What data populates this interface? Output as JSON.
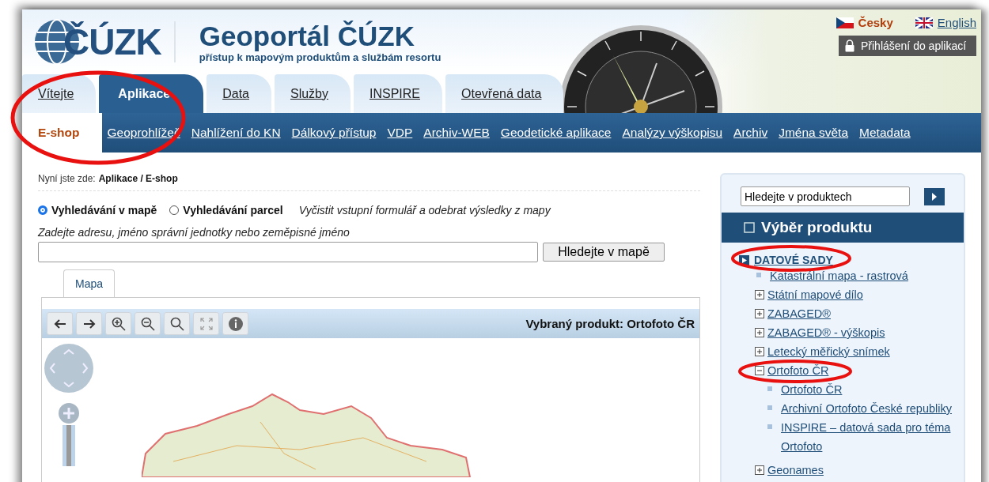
{
  "header": {
    "logo_text": "ČÚZK",
    "title": "Geoportál ČÚZK",
    "subtitle": "přístup k mapovým produktům a službám resortu",
    "languages": [
      {
        "label": "Česky",
        "selected": true
      },
      {
        "label": "English",
        "selected": false
      }
    ],
    "login_button": "Přihlášení do aplikací"
  },
  "tabs": [
    {
      "label": "Vítejte",
      "selected": false
    },
    {
      "label": "Aplikace",
      "selected": true
    },
    {
      "label": "Data",
      "selected": false
    },
    {
      "label": "Služby",
      "selected": false
    },
    {
      "label": "INSPIRE",
      "selected": false
    },
    {
      "label": "Otevřená data",
      "selected": false
    }
  ],
  "subnav": [
    {
      "label": "E-shop",
      "selected": true
    },
    {
      "label": "Geoprohlížeč",
      "selected": false
    },
    {
      "label": "Nahlížení do KN",
      "selected": false
    },
    {
      "label": "Dálkový přístup",
      "selected": false
    },
    {
      "label": "VDP",
      "selected": false
    },
    {
      "label": "Archiv-WEB",
      "selected": false
    },
    {
      "label": "Geodetické aplikace",
      "selected": false
    },
    {
      "label": "Analýzy výškopisu",
      "selected": false
    },
    {
      "label": "Archiv",
      "selected": false
    },
    {
      "label": "Jména světa",
      "selected": false
    },
    {
      "label": "Metadata",
      "selected": false
    }
  ],
  "breadcrumb": {
    "prefix": "Nyní jste zde:",
    "path": "Aplikace / E-shop"
  },
  "search_modes": [
    {
      "label": "Vyhledávání v mapě",
      "selected": true
    },
    {
      "label": "Vyhledávání parcel",
      "selected": false
    }
  ],
  "clear_link": "Vyčistit vstupní formulář a odebrat výsledky z mapy",
  "address_label": "Zadejte adresu, jméno správní jednotky nebo zeměpisné jméno",
  "search_button": "Hledejte v mapě",
  "view_tabs": [
    {
      "label": "Mapa",
      "selected": true
    }
  ],
  "map": {
    "selected_product": "Vybraný produkt: Ortofoto ČR"
  },
  "sidebar": {
    "search_value": "Hledejte v produktech",
    "panel_title": "Výběr produktu",
    "section": "DATOVÉ SADY",
    "tree": [
      {
        "label": "Katastrální mapa - rastrová",
        "kind": "leaf"
      },
      {
        "label": "Státní mapové dílo",
        "kind": "group",
        "expanded": false
      },
      {
        "label": "ZABAGED®",
        "kind": "group",
        "expanded": false
      },
      {
        "label": "ZABAGED® - výškopis",
        "kind": "group",
        "expanded": false
      },
      {
        "label": "Letecký měřický snímek",
        "kind": "group",
        "expanded": false
      },
      {
        "label": "Ortofoto ČR",
        "kind": "group",
        "expanded": true,
        "children": [
          {
            "label": "Ortofoto ČR",
            "kind": "leaf"
          },
          {
            "label": "Archivní Ortofoto České republiky",
            "kind": "leaf"
          },
          {
            "label": "INSPIRE – datová sada pro téma Ortofoto",
            "kind": "leaf"
          }
        ]
      },
      {
        "label": "Geonames",
        "kind": "group",
        "expanded": false
      }
    ]
  }
}
